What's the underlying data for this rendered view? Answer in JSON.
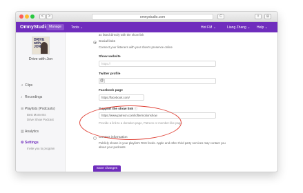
{
  "browser": {
    "back": "<",
    "forward": ">",
    "url": "omnystudio.com",
    "reload": "C",
    "share": "⇪",
    "tabs": "⊞"
  },
  "topbar": {
    "brand": "OmnyStudio",
    "manage": "Manage",
    "tools": "Tools ⌄",
    "network": "Hot FM ⌄",
    "user": "Liang Zhang ⌄",
    "help": "Help ⌄"
  },
  "sidebar": {
    "cover_text": "DRIVE with JON",
    "show_name": "Drive with Jon",
    "clips": "Clips",
    "recordings": "Recordings",
    "playlists": "Playlists (Podcasts)",
    "playlist_sub1": "Best Moments",
    "playlist_sub2": "Drive Show Podcast",
    "analytics": "Analytics",
    "settings": "Settings",
    "settings_sub": "Invite you to program"
  },
  "form": {
    "intro_tail": "as listed directly with the show link",
    "social_title": "Social links",
    "social_desc": "Connect your listeners with your show's presence online",
    "website_label": "Show website",
    "website_placeholder": "https://",
    "twitter_label": "Twitter profile",
    "twitter_prefix": "@",
    "facebook_label": "Facebook page",
    "facebook_value": "https://facebook.com/",
    "support_label": "Support the show link",
    "support_value": "https://www.patreon.com/loftermotionshow",
    "support_help": "Provide a link to a donation page, Patreon or member-like page",
    "contact_title": "Contact information",
    "contact_desc_1": "Publicly shown in your playlist's RSS feeds. Apple and other third party services may contact you",
    "contact_desc_2": "about your podcasts",
    "save_label": "Save changes"
  },
  "colors": {
    "brand": "#6f2dbd",
    "highlight": "#e0453a"
  }
}
